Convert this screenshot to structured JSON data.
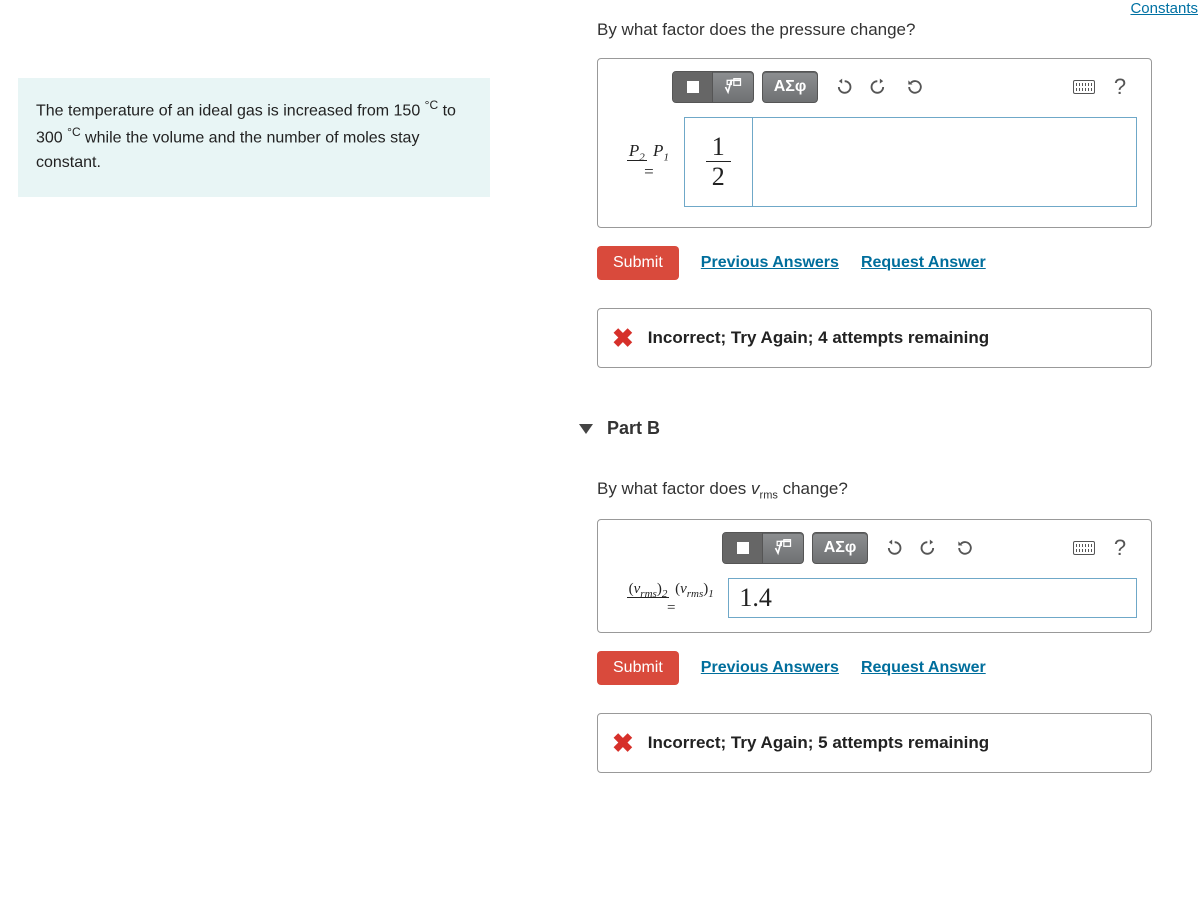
{
  "constants_link": "Constants",
  "problem_text_a": "The temperature of an ideal gas is increased from 150 ",
  "problem_unit1": "°C",
  "problem_text_b": " to 300 ",
  "problem_unit2": "°C",
  "problem_text_c": " while the volume and the number of moles stay constant.",
  "partA": {
    "question": "By what factor does the pressure change?",
    "lhs_num": "P",
    "lhs_num_sub": "2",
    "lhs_den": "P",
    "lhs_den_sub": "1",
    "equals": "=",
    "answer_num": "1",
    "answer_den": "2",
    "submit": "Submit",
    "prev": "Previous Answers",
    "request": "Request Answer",
    "feedback": "Incorrect; Try Again; 4 attempts remaining"
  },
  "partB": {
    "title": "Part B",
    "question_a": "By what factor does ",
    "question_var": "v",
    "question_sub": "rms",
    "question_b": " change?",
    "lhs_num_a": "(v",
    "lhs_num_sub": "rms",
    "lhs_num_b": ")",
    "lhs_num_idx": "2",
    "lhs_den_a": "(v",
    "lhs_den_sub": "rms",
    "lhs_den_b": ")",
    "lhs_den_idx": "1",
    "equals": "=",
    "answer": "1.4",
    "submit": "Submit",
    "prev": "Previous Answers",
    "request": "Request Answer",
    "feedback": "Incorrect; Try Again; 5 attempts remaining"
  },
  "toolbar": {
    "greek": "ΑΣφ",
    "help": "?"
  }
}
